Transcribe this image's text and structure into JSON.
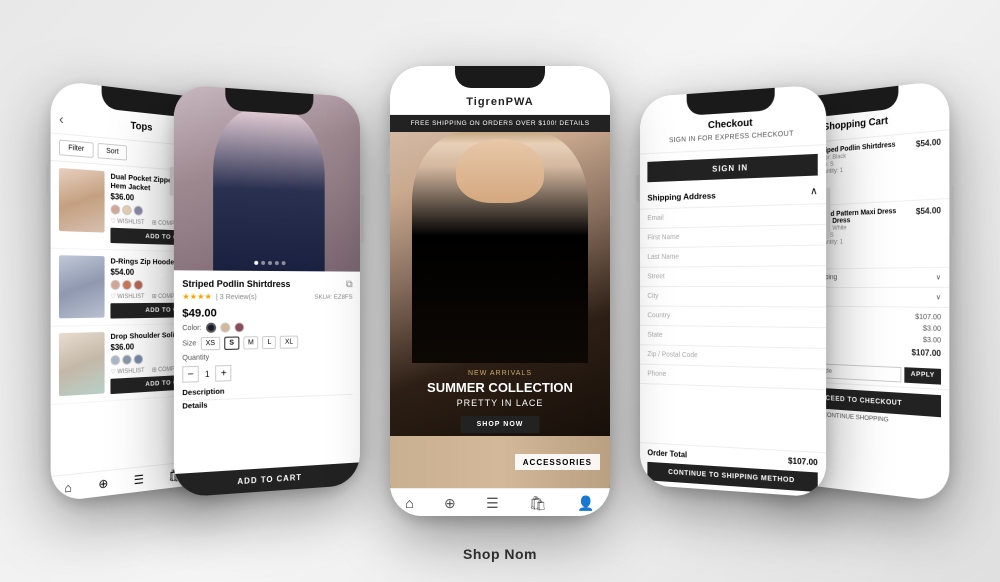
{
  "app": {
    "name": "TigrenPWA",
    "tagline": "Shop Nom"
  },
  "phones": {
    "center": {
      "topBar": "TigrenPWA",
      "promoBar": "FREE SHIPPING ON ORDERS OVER $100! DETAILS",
      "hero": {
        "badge": "NEW ARRIVALS",
        "title": "SUMMER COLLECTION",
        "subtitle": "PRETTY IN LACE",
        "shopBtn": "SHOP NOW"
      },
      "accessories": "ACCESSORIES",
      "nav": [
        "🏠",
        "🔍",
        "☰",
        "🛍",
        "👤"
      ]
    },
    "left1": {
      "productName": "Striped Podlin Shirtdress",
      "sku": "SKU#: EZ8FS",
      "price": "$49.00",
      "rating": "★★★★",
      "reviews": "3 Review(s)",
      "colorLabel": "Color:",
      "colors": [
        "#1a1a2e",
        "#d4b89a",
        "#8b4a5a"
      ],
      "sizeLabel": "Size",
      "sizes": [
        "XS",
        "S",
        "M",
        "L",
        "XL"
      ],
      "selectedSize": "S",
      "quantityLabel": "Quantity",
      "quantity": "1",
      "descriptionLabel": "Description",
      "detailsLabel": "Details",
      "addToCart": "ADD TO CART"
    },
    "left2": {
      "category": "Tops",
      "filterBtn": "Filter",
      "sortBtn": "Sort",
      "items": [
        {
          "name": "Dual Pocket Zipper Drawstring Hem Jacket",
          "price": "$36.00",
          "colors": [
            "#d4a898",
            "#e8d0b0",
            "#8888aa"
          ],
          "actions": [
            "WISHLIST",
            "COMPARE"
          ],
          "addBtn": "ADD TO CART"
        },
        {
          "name": "D-Rings Zip Hooded Jacket",
          "price": "$54.00",
          "colors": [
            "#d4a898",
            "#cc7755",
            "#bb6655"
          ],
          "actions": [
            "WISHLIST",
            "COMPARE"
          ],
          "addBtn": "ADD TO CART"
        },
        {
          "name": "Drop Shoulder Solid Teddy Jacket",
          "price": "$36.00",
          "colors": [
            "#a8b8c8",
            "#8899aa",
            "#7788aa"
          ],
          "actions": [
            "WISHLIST",
            "COMPARE"
          ],
          "addBtn": "ADD TO CART"
        }
      ]
    },
    "right1": {
      "title": "Checkout",
      "expressText": "SIGN IN FOR EXPRESS CHECKOUT",
      "signInBtn": "SIGN IN",
      "shippingAddress": "Shipping Address",
      "fields": [
        "Email",
        "First Name",
        "Last Name",
        "Street",
        "City",
        "Country",
        "State",
        "Zip / Postal Code",
        "Phone"
      ],
      "orderTotal": "$107.00",
      "orderTotalLabel": "Order Total",
      "continueBtn": "CONTINUE TO SHIPPING METHOD"
    },
    "right2": {
      "title": "Shopping Cart",
      "items": [
        {
          "name": "Striped Podlin Shirtdress",
          "detail1": "Color: Black",
          "detail2": "Size: S",
          "detail3": "Quantity: 1",
          "price": "$54.00"
        },
        {
          "name": "Mixed Pattern Maxi Dress Maxi Dress",
          "detail1": "Color: White",
          "detail2": "Size: S",
          "detail3": "Quantity: 1",
          "price": "$54.00"
        }
      ],
      "estimateShipping": "stimate Your Shipping",
      "giftOptions": "s Gift Options",
      "subtotalLabel": "subtotal",
      "subtotal": "$107.00",
      "taxLabel": "x",
      "tax": "$3.00",
      "discountLabel": "scount",
      "discount": "$3.00",
      "totalLabel": "der Total",
      "total": "$107.00",
      "discountPlaceholder": "nd a Discount Code",
      "applyBtn": "APPLY",
      "checkoutBtn": "PROCEED TO CHECKOUT",
      "continueLink": "CONTINUE SHOPPING"
    }
  }
}
